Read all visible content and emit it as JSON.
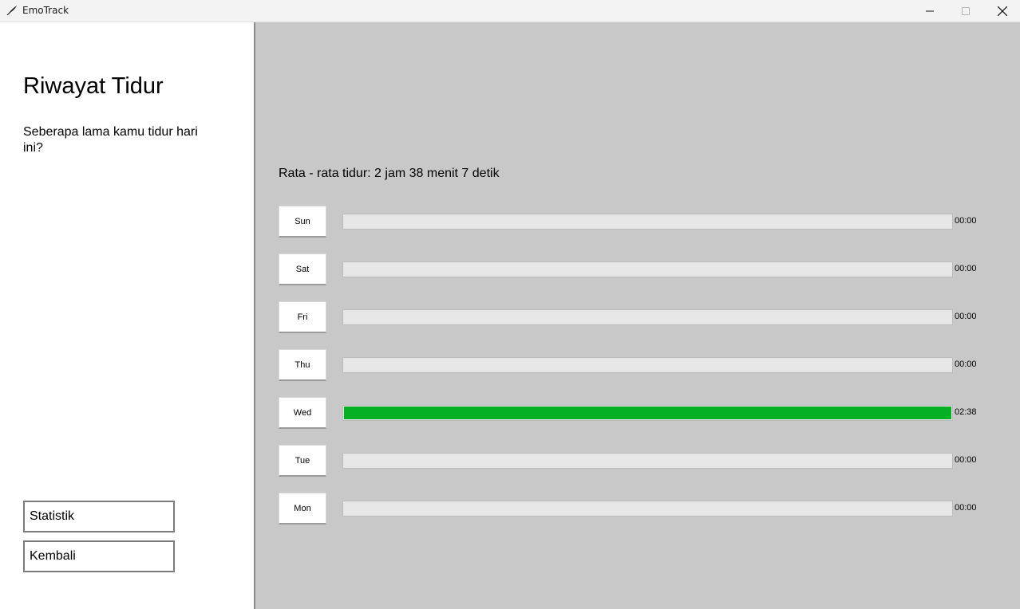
{
  "window": {
    "title": "EmoTrack",
    "app_icon": "feather-icon",
    "controls": [
      "minimize-icon",
      "maximize-icon",
      "close-icon"
    ]
  },
  "sidebar": {
    "title": "Riwayat Tidur",
    "question": "Seberapa lama kamu tidur hari ini?",
    "buttons": {
      "statistik": "Statistik",
      "kembali": "Kembali"
    }
  },
  "main": {
    "average_text": "Rata - rata tidur: 2 jam 38 menit 7 detik",
    "days": [
      {
        "day": "Sun",
        "time": "00:00",
        "fill": 0
      },
      {
        "day": "Sat",
        "time": "00:00",
        "fill": 0
      },
      {
        "day": "Fri",
        "time": "00:00",
        "fill": 0
      },
      {
        "day": "Thu",
        "time": "00:00",
        "fill": 0
      },
      {
        "day": "Wed",
        "time": "02:38",
        "fill": 1
      },
      {
        "day": "Tue",
        "time": "00:00",
        "fill": 0
      },
      {
        "day": "Mon",
        "time": "00:00",
        "fill": 0
      }
    ]
  },
  "colors": {
    "progress_fill": "#06b025",
    "panel_background": "#c8c8c8"
  }
}
